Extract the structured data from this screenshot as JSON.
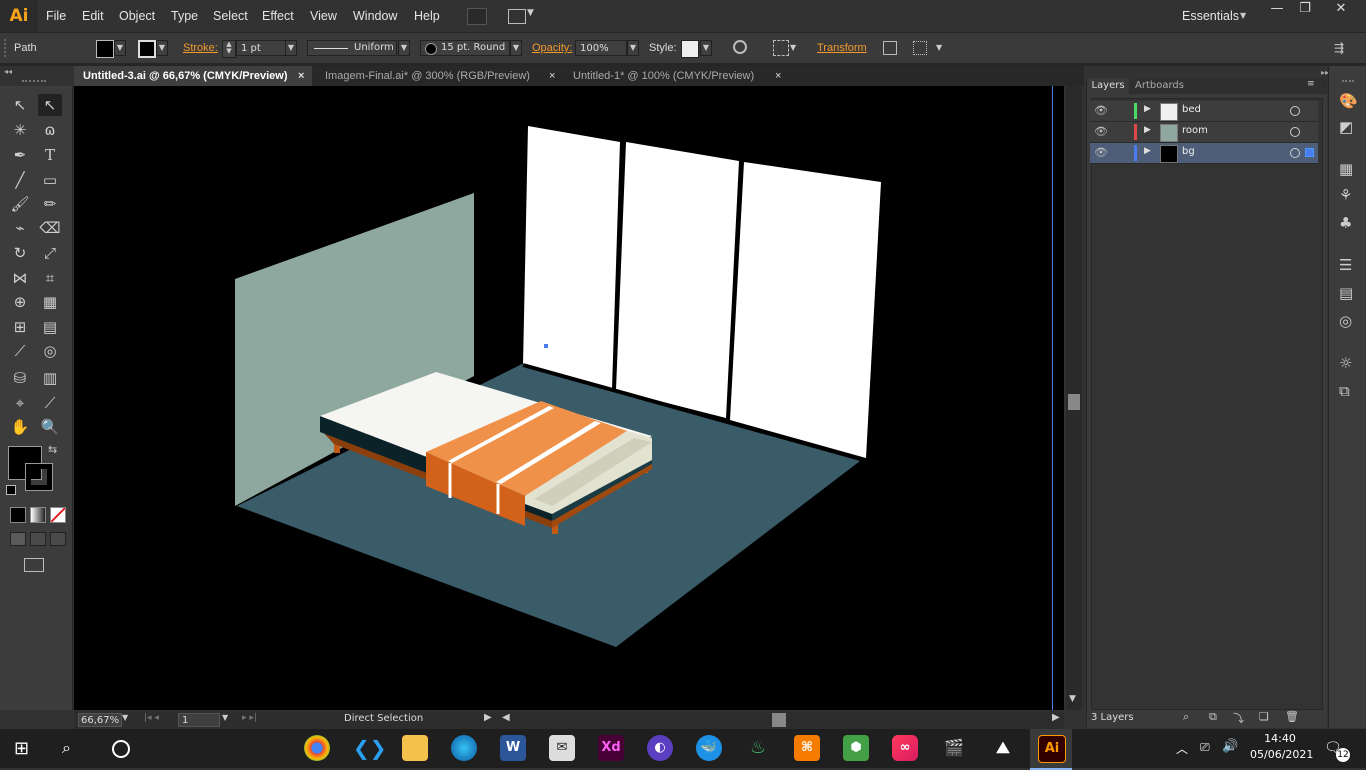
{
  "app": {
    "logo": "Ai",
    "workspace": "Essentials"
  },
  "menu": [
    "File",
    "Edit",
    "Object",
    "Type",
    "Select",
    "Effect",
    "View",
    "Window",
    "Help"
  ],
  "control": {
    "selection_label": "Path",
    "stroke_label": "Stroke:",
    "stroke_weight": "1 pt",
    "stroke_profile": "Uniform",
    "brush": "15 pt. Round",
    "opacity_label": "Opacity:",
    "opacity_value": "100%",
    "style_label": "Style:",
    "transform_label": "Transform"
  },
  "tabs": [
    {
      "label": "Untitled-3.ai @ 66,67% (CMYK/Preview)",
      "active": true
    },
    {
      "label": "Imagem-Final.ai* @ 300% (RGB/Preview)",
      "active": false
    },
    {
      "label": "Untitled-1* @ 100% (CMYK/Preview)",
      "active": false
    }
  ],
  "status": {
    "zoom": "66,67%",
    "artboard": "1",
    "tool": "Direct Selection"
  },
  "panel": {
    "tabs": [
      "Layers",
      "Artboards"
    ],
    "layers": [
      {
        "name": "bed",
        "color": "#4cd964",
        "selected": false
      },
      {
        "name": "room",
        "color": "#e04848",
        "selected": false
      },
      {
        "name": "bg",
        "color": "#4a7cf0",
        "selected": true
      }
    ],
    "footer": "3 Layers"
  },
  "taskbar": {
    "time": "14:40",
    "date": "05/06/2021",
    "notifications": "12"
  },
  "colors": {
    "wall": "#8fa89f",
    "floor": "#3a5b68",
    "blanket": "#f0914a",
    "blanket_dark": "#d2621a",
    "window": "#ffffff",
    "accent": "#f29a2e"
  }
}
